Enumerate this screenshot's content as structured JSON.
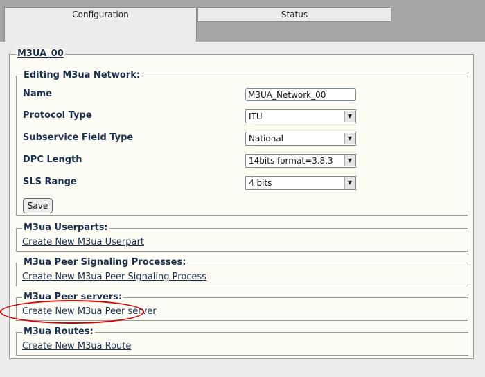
{
  "tabs": [
    {
      "label": "Configuration"
    },
    {
      "label": "Status"
    }
  ],
  "main": {
    "title": "M3UA_00",
    "editing": {
      "legend": "Editing M3ua Network:",
      "fields": [
        {
          "label": "Name",
          "value": "M3UA_Network_00"
        },
        {
          "label": "Protocol Type",
          "value": "ITU"
        },
        {
          "label": "Subservice Field Type",
          "value": "National"
        },
        {
          "label": "DPC Length",
          "value": "14bits format=3.8.3"
        },
        {
          "label": "SLS Range",
          "value": "4 bits"
        }
      ],
      "save_label": "Save"
    },
    "sections": [
      {
        "legend": "M3ua Userparts:",
        "link": "Create New M3ua Userpart"
      },
      {
        "legend": "M3ua Peer Signaling Processes:",
        "link": "Create New M3ua Peer Signaling Process"
      },
      {
        "legend": "M3ua Peer servers:",
        "link": "Create New M3ua Peer server"
      },
      {
        "legend": "M3ua Routes:",
        "link": "Create New M3ua Route"
      }
    ]
  },
  "annotation_color": "#d00000"
}
